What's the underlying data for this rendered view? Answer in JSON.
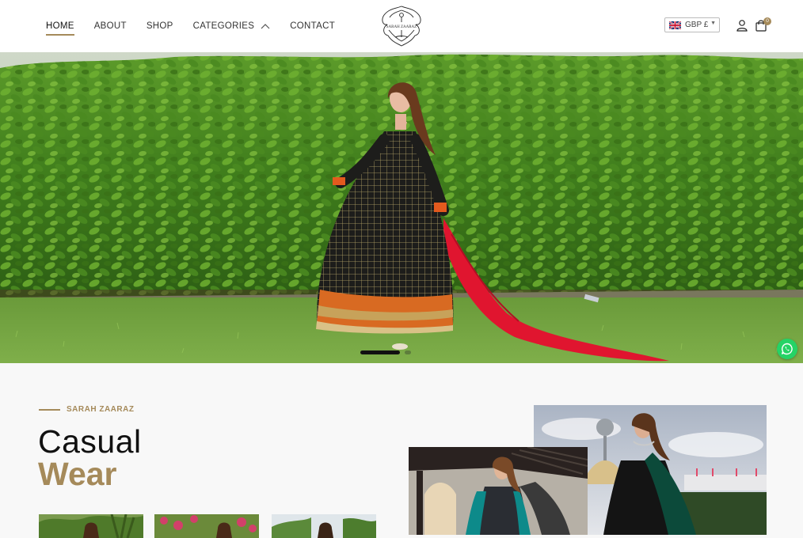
{
  "nav": {
    "items": [
      {
        "label": "HOME",
        "active": true
      },
      {
        "label": "ABOUT"
      },
      {
        "label": "SHOP"
      },
      {
        "label": "CATEGORIES",
        "has_dropdown": true
      },
      {
        "label": "CONTACT"
      }
    ]
  },
  "brand": {
    "logo_text": "SARAH ZAARAZ"
  },
  "currency": {
    "selected": "GBP £",
    "flag": "uk-flag-icon"
  },
  "cart": {
    "count": "0"
  },
  "hero": {
    "slides_total": 2,
    "active_slide": 1
  },
  "section": {
    "eyebrow": "SARAH ZAARAZ",
    "heading_line1": "Casual",
    "heading_line2": "Wear"
  },
  "colors": {
    "accent": "#a58a5a",
    "text": "#111111",
    "whatsapp": "#25d366"
  },
  "icons": [
    "chevron-up-icon",
    "user-icon",
    "shopping-bag-icon",
    "whatsapp-icon"
  ]
}
